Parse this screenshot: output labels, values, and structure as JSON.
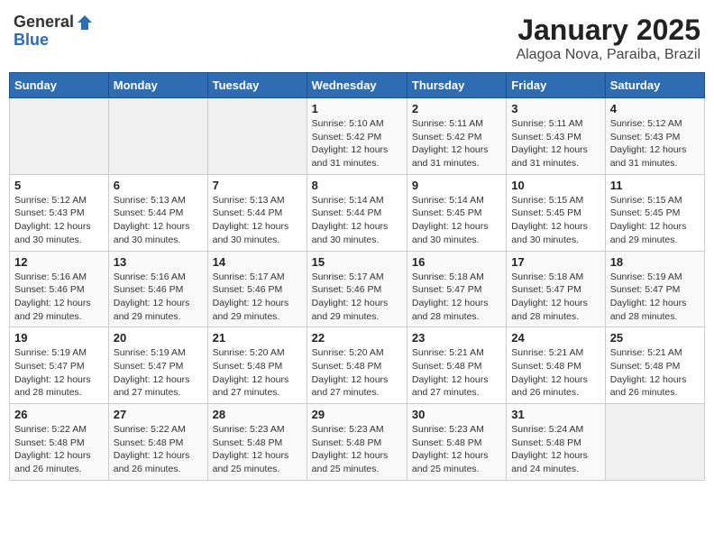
{
  "header": {
    "logo_general": "General",
    "logo_blue": "Blue",
    "month": "January 2025",
    "location": "Alagoa Nova, Paraiba, Brazil"
  },
  "weekdays": [
    "Sunday",
    "Monday",
    "Tuesday",
    "Wednesday",
    "Thursday",
    "Friday",
    "Saturday"
  ],
  "weeks": [
    [
      {
        "day": "",
        "sunrise": "",
        "sunset": "",
        "daylight": ""
      },
      {
        "day": "",
        "sunrise": "",
        "sunset": "",
        "daylight": ""
      },
      {
        "day": "",
        "sunrise": "",
        "sunset": "",
        "daylight": ""
      },
      {
        "day": "1",
        "sunrise": "Sunrise: 5:10 AM",
        "sunset": "Sunset: 5:42 PM",
        "daylight": "Daylight: 12 hours and 31 minutes."
      },
      {
        "day": "2",
        "sunrise": "Sunrise: 5:11 AM",
        "sunset": "Sunset: 5:42 PM",
        "daylight": "Daylight: 12 hours and 31 minutes."
      },
      {
        "day": "3",
        "sunrise": "Sunrise: 5:11 AM",
        "sunset": "Sunset: 5:43 PM",
        "daylight": "Daylight: 12 hours and 31 minutes."
      },
      {
        "day": "4",
        "sunrise": "Sunrise: 5:12 AM",
        "sunset": "Sunset: 5:43 PM",
        "daylight": "Daylight: 12 hours and 31 minutes."
      }
    ],
    [
      {
        "day": "5",
        "sunrise": "Sunrise: 5:12 AM",
        "sunset": "Sunset: 5:43 PM",
        "daylight": "Daylight: 12 hours and 30 minutes."
      },
      {
        "day": "6",
        "sunrise": "Sunrise: 5:13 AM",
        "sunset": "Sunset: 5:44 PM",
        "daylight": "Daylight: 12 hours and 30 minutes."
      },
      {
        "day": "7",
        "sunrise": "Sunrise: 5:13 AM",
        "sunset": "Sunset: 5:44 PM",
        "daylight": "Daylight: 12 hours and 30 minutes."
      },
      {
        "day": "8",
        "sunrise": "Sunrise: 5:14 AM",
        "sunset": "Sunset: 5:44 PM",
        "daylight": "Daylight: 12 hours and 30 minutes."
      },
      {
        "day": "9",
        "sunrise": "Sunrise: 5:14 AM",
        "sunset": "Sunset: 5:45 PM",
        "daylight": "Daylight: 12 hours and 30 minutes."
      },
      {
        "day": "10",
        "sunrise": "Sunrise: 5:15 AM",
        "sunset": "Sunset: 5:45 PM",
        "daylight": "Daylight: 12 hours and 30 minutes."
      },
      {
        "day": "11",
        "sunrise": "Sunrise: 5:15 AM",
        "sunset": "Sunset: 5:45 PM",
        "daylight": "Daylight: 12 hours and 29 minutes."
      }
    ],
    [
      {
        "day": "12",
        "sunrise": "Sunrise: 5:16 AM",
        "sunset": "Sunset: 5:46 PM",
        "daylight": "Daylight: 12 hours and 29 minutes."
      },
      {
        "day": "13",
        "sunrise": "Sunrise: 5:16 AM",
        "sunset": "Sunset: 5:46 PM",
        "daylight": "Daylight: 12 hours and 29 minutes."
      },
      {
        "day": "14",
        "sunrise": "Sunrise: 5:17 AM",
        "sunset": "Sunset: 5:46 PM",
        "daylight": "Daylight: 12 hours and 29 minutes."
      },
      {
        "day": "15",
        "sunrise": "Sunrise: 5:17 AM",
        "sunset": "Sunset: 5:46 PM",
        "daylight": "Daylight: 12 hours and 29 minutes."
      },
      {
        "day": "16",
        "sunrise": "Sunrise: 5:18 AM",
        "sunset": "Sunset: 5:47 PM",
        "daylight": "Daylight: 12 hours and 28 minutes."
      },
      {
        "day": "17",
        "sunrise": "Sunrise: 5:18 AM",
        "sunset": "Sunset: 5:47 PM",
        "daylight": "Daylight: 12 hours and 28 minutes."
      },
      {
        "day": "18",
        "sunrise": "Sunrise: 5:19 AM",
        "sunset": "Sunset: 5:47 PM",
        "daylight": "Daylight: 12 hours and 28 minutes."
      }
    ],
    [
      {
        "day": "19",
        "sunrise": "Sunrise: 5:19 AM",
        "sunset": "Sunset: 5:47 PM",
        "daylight": "Daylight: 12 hours and 28 minutes."
      },
      {
        "day": "20",
        "sunrise": "Sunrise: 5:19 AM",
        "sunset": "Sunset: 5:47 PM",
        "daylight": "Daylight: 12 hours and 27 minutes."
      },
      {
        "day": "21",
        "sunrise": "Sunrise: 5:20 AM",
        "sunset": "Sunset: 5:48 PM",
        "daylight": "Daylight: 12 hours and 27 minutes."
      },
      {
        "day": "22",
        "sunrise": "Sunrise: 5:20 AM",
        "sunset": "Sunset: 5:48 PM",
        "daylight": "Daylight: 12 hours and 27 minutes."
      },
      {
        "day": "23",
        "sunrise": "Sunrise: 5:21 AM",
        "sunset": "Sunset: 5:48 PM",
        "daylight": "Daylight: 12 hours and 27 minutes."
      },
      {
        "day": "24",
        "sunrise": "Sunrise: 5:21 AM",
        "sunset": "Sunset: 5:48 PM",
        "daylight": "Daylight: 12 hours and 26 minutes."
      },
      {
        "day": "25",
        "sunrise": "Sunrise: 5:21 AM",
        "sunset": "Sunset: 5:48 PM",
        "daylight": "Daylight: 12 hours and 26 minutes."
      }
    ],
    [
      {
        "day": "26",
        "sunrise": "Sunrise: 5:22 AM",
        "sunset": "Sunset: 5:48 PM",
        "daylight": "Daylight: 12 hours and 26 minutes."
      },
      {
        "day": "27",
        "sunrise": "Sunrise: 5:22 AM",
        "sunset": "Sunset: 5:48 PM",
        "daylight": "Daylight: 12 hours and 26 minutes."
      },
      {
        "day": "28",
        "sunrise": "Sunrise: 5:23 AM",
        "sunset": "Sunset: 5:48 PM",
        "daylight": "Daylight: 12 hours and 25 minutes."
      },
      {
        "day": "29",
        "sunrise": "Sunrise: 5:23 AM",
        "sunset": "Sunset: 5:48 PM",
        "daylight": "Daylight: 12 hours and 25 minutes."
      },
      {
        "day": "30",
        "sunrise": "Sunrise: 5:23 AM",
        "sunset": "Sunset: 5:48 PM",
        "daylight": "Daylight: 12 hours and 25 minutes."
      },
      {
        "day": "31",
        "sunrise": "Sunrise: 5:24 AM",
        "sunset": "Sunset: 5:48 PM",
        "daylight": "Daylight: 12 hours and 24 minutes."
      },
      {
        "day": "",
        "sunrise": "",
        "sunset": "",
        "daylight": ""
      }
    ]
  ]
}
